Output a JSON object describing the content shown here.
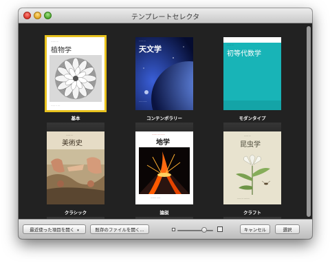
{
  "window": {
    "title": "テンプレートセレクタ"
  },
  "templates": [
    {
      "label": "基本",
      "cover_title": "植物学",
      "selected": true
    },
    {
      "label": "コンテンポラリー",
      "cover_title": "天文学",
      "selected": false
    },
    {
      "label": "モダンタイプ",
      "cover_title": "初等代数学",
      "selected": false
    },
    {
      "label": "クラシック",
      "cover_title": "美術史",
      "selected": false
    },
    {
      "label": "論説",
      "cover_title": "地学",
      "selected": false
    },
    {
      "label": "クラフト",
      "cover_title": "昆虫学",
      "selected": false
    }
  ],
  "toolbar": {
    "recent_button": "最近使った項目を開く",
    "open_existing_button": "既存のファイルを開く...",
    "cancel_button": "キャンセル",
    "choose_button": "選択",
    "zoom_level": 0.75
  }
}
